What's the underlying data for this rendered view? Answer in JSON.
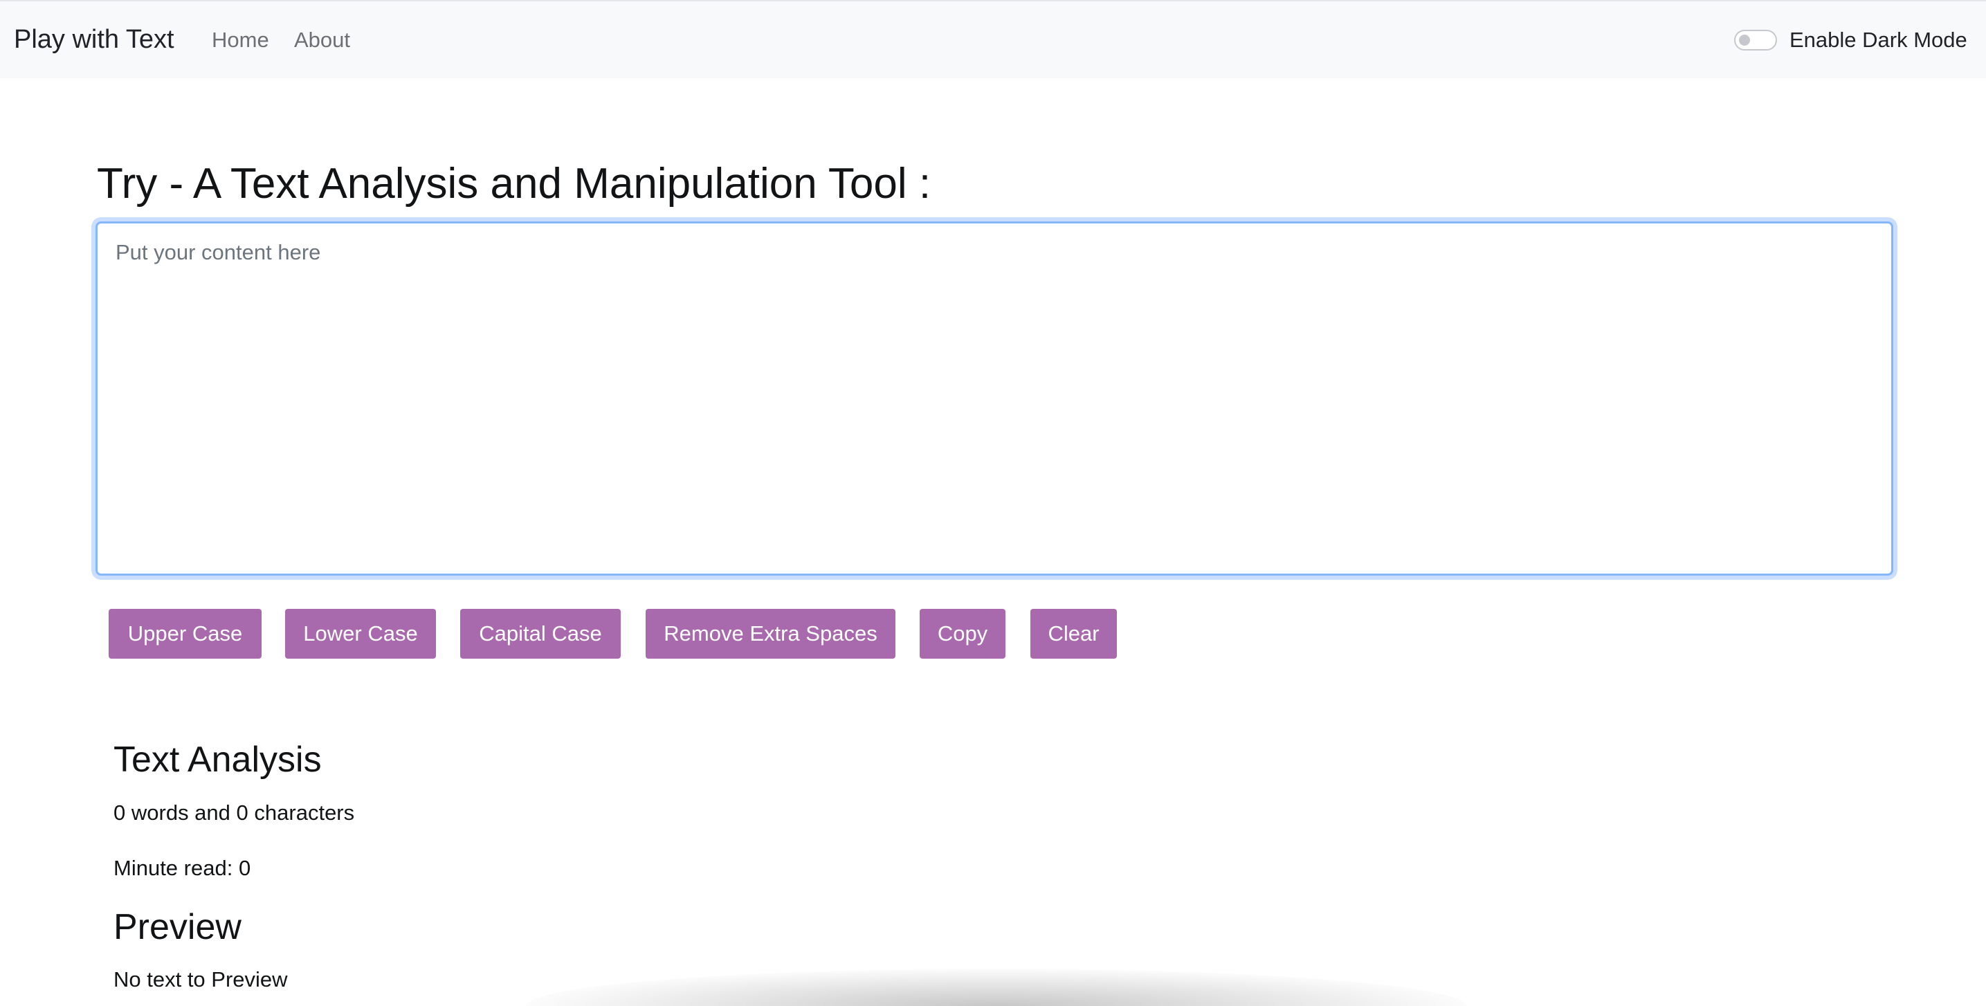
{
  "navbar": {
    "brand": "Play with Text",
    "links": [
      "Home",
      "About"
    ],
    "dark_mode_label": "Enable Dark Mode"
  },
  "main": {
    "heading": "Try - A Text Analysis and Manipulation Tool :",
    "textarea": {
      "value": "",
      "placeholder": "Put your content here"
    },
    "buttons": {
      "upper": "Upper Case",
      "lower": "Lower Case",
      "capital": "Capital Case",
      "remove_spaces": "Remove Extra Spaces",
      "copy": "Copy",
      "clear": "Clear"
    },
    "button_color": "#a86aad",
    "focus_color": "#86b7fe"
  },
  "analysis": {
    "title": "Text Analysis",
    "word_count": "0",
    "words_and": "words and",
    "char_count": "0",
    "characters": "characters",
    "minute_read_label": "Minute read:",
    "minute_read_value": "0"
  },
  "preview": {
    "title": "Preview",
    "text": "No text to Preview"
  }
}
